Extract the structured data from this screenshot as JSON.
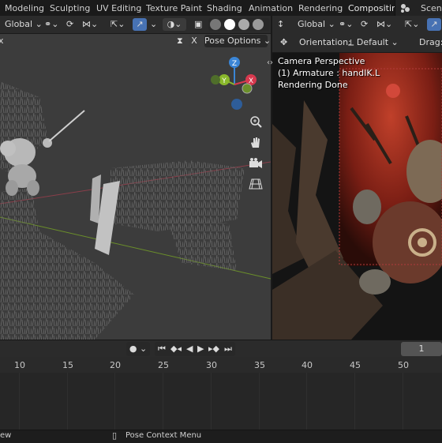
{
  "workspace_tabs": [
    "Modeling",
    "Sculpting",
    "UV Editing",
    "Texture Paint",
    "Shading",
    "Animation",
    "Rendering",
    "Compositin"
  ],
  "scene_label": "Scen",
  "left_header": {
    "orientation_value": "Global",
    "menu_fragment": "x",
    "pose_options": "Pose Options",
    "x_toggle": "X"
  },
  "right_header": {
    "orientation_value": "Global",
    "orientation_label": "Orientation:",
    "orientation_default": "Default",
    "drag_label": "Drag:"
  },
  "viewport_overlay": {
    "line1": "Camera Perspective",
    "line2": "(1) Armature : handIK.L",
    "line3": "Rendering Done"
  },
  "nav_gizmo": {
    "z": "Z",
    "y": "Y",
    "x": "X"
  },
  "timeline": {
    "current_frame": "1",
    "ruler_ticks": [
      "10",
      "15",
      "20",
      "25",
      "30",
      "35",
      "40",
      "45",
      "50"
    ]
  },
  "statusbar": {
    "left_fragment": "ew",
    "context_menu": "Pose Context Menu"
  },
  "colors": {
    "accent": "#4772b3",
    "gizmo_x": "#d7394e",
    "gizmo_y": "#8ab82b",
    "gizmo_z": "#3a85d6"
  }
}
